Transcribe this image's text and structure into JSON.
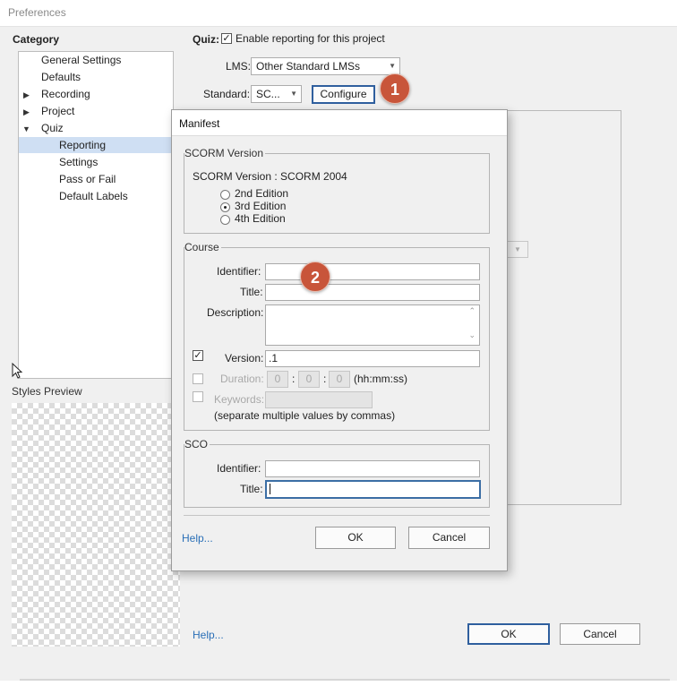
{
  "window": {
    "title": "Preferences"
  },
  "category": {
    "heading": "Category",
    "items": [
      {
        "label": "General Settings"
      },
      {
        "label": "Defaults"
      },
      {
        "label": "Recording"
      },
      {
        "label": "Project"
      },
      {
        "label": "Quiz"
      },
      {
        "label": "Reporting"
      },
      {
        "label": "Settings"
      },
      {
        "label": "Pass or Fail"
      },
      {
        "label": "Default Labels"
      }
    ],
    "selected": "Reporting"
  },
  "styles_preview": {
    "label": "Styles Preview"
  },
  "quiz": {
    "label": "Quiz:",
    "enable_reporting": {
      "label": "Enable reporting for this project",
      "checked": true,
      "mark": "✓"
    },
    "lms": {
      "label": "LMS:",
      "value": "Other Standard LMSs"
    },
    "standard": {
      "label": "Standard:",
      "value": "SC..."
    },
    "configure_button": "Configure"
  },
  "callouts": {
    "one": "1",
    "two": "2"
  },
  "main_buttons": {
    "help": "Help...",
    "ok": "OK",
    "cancel": "Cancel"
  },
  "manifest": {
    "title": "Manifest",
    "scorm_version_group": "SCORM Version",
    "scorm_version_text": "SCORM Version : SCORM 2004",
    "editions": [
      {
        "label": "2nd Edition",
        "selected": false
      },
      {
        "label": "3rd Edition",
        "selected": true
      },
      {
        "label": "4th Edition",
        "selected": false
      }
    ],
    "course": {
      "group": "Course",
      "identifier_label": "Identifier:",
      "identifier_value": "",
      "title_label": "Title:",
      "title_value": "",
      "description_label": "Description:",
      "description_value": "",
      "version_label": "Version:",
      "version_value": ".1",
      "version_checked": true,
      "duration_label": "Duration:",
      "duration_hh": "0",
      "duration_mm": "0",
      "duration_ss": "0",
      "duration_sep": ":",
      "duration_format": "(hh:mm:ss)",
      "keywords_label": "Keywords:",
      "keywords_value": "",
      "keywords_hint": "(separate multiple values by commas)"
    },
    "sco": {
      "group": "SCO",
      "identifier_label": "Identifier:",
      "identifier_value": "",
      "title_label": "Title:",
      "title_value": ""
    },
    "help": "Help...",
    "ok": "OK",
    "cancel": "Cancel"
  },
  "colors": {
    "selection": "#cfdff3",
    "link": "#2a6fb7",
    "callout": "#c8553a",
    "focus_border": "#2f5f9e"
  }
}
